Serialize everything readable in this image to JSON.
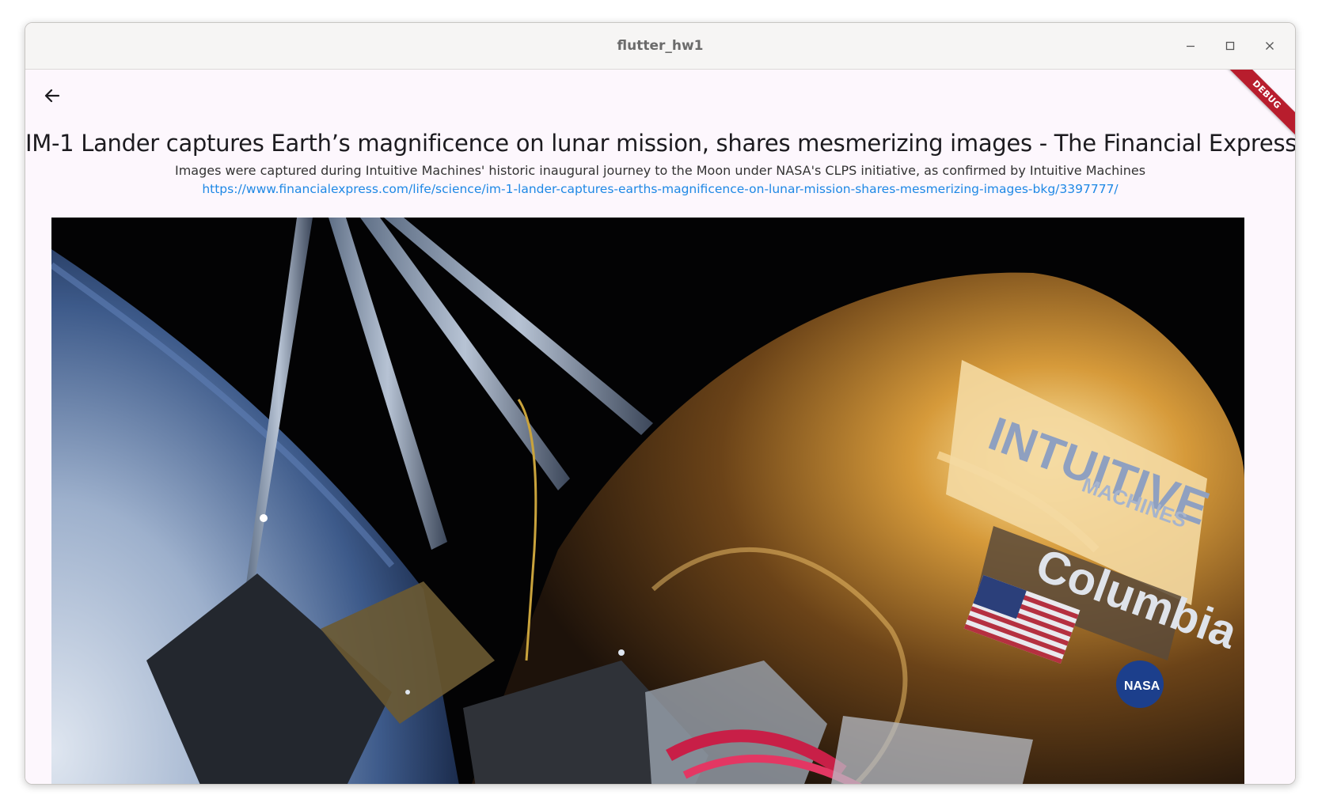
{
  "window": {
    "title": "flutter_hw1",
    "controls": [
      "minimize-icon",
      "maximize-icon",
      "close-icon"
    ]
  },
  "app_bar": {
    "back_icon": "arrow-left-icon",
    "debug_banner": "DEBUG"
  },
  "article": {
    "headline": "IM-1 Lander captures Earth’s magnificence on lunar mission, shares mesmerizing images - The Financial Express",
    "description": "Images were captured during Intuitive Machines' historic inaugural journey to the Moon under NASA's CLPS initiative, as confirmed by Intuitive Machines",
    "url": "https://www.financialexpress.com/life/science/im-1-lander-captures-earths-magnificence-on-lunar-mission-shares-mesmerizing-images-bkg/3397777/",
    "image": {
      "logo_text_1": "INTUITIVE",
      "logo_text_2": "MACHINES",
      "brand_text": "Columbia",
      "agency_text": "NASA"
    }
  },
  "colors": {
    "link": "#1e88e5",
    "background": "#fdf7fd",
    "debug": "#b81d2d"
  }
}
